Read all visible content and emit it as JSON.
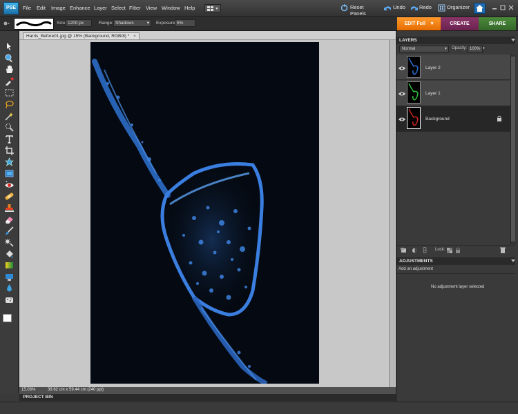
{
  "app": {
    "logo": "PSE"
  },
  "menu": [
    "File",
    "Edit",
    "Image",
    "Enhance",
    "Layer",
    "Select",
    "Filter",
    "View",
    "Window",
    "Help"
  ],
  "menu_right": {
    "reset_panels": "Reset Panels",
    "undo": "Undo",
    "redo": "Redo",
    "organizer": "Organizer"
  },
  "options": {
    "size_label": "Size:",
    "size_value": "1200 px",
    "range_label": "Range:",
    "range_value": "Shadows",
    "exposure_label": "Exposure:",
    "exposure_value": "5%"
  },
  "modes": {
    "edit": "EDIT Full",
    "create": "CREATE",
    "share": "SHARE"
  },
  "document": {
    "tab_title": "Harris_Before01.jpg @ 15% (Background, RGB/8) *"
  },
  "status": {
    "zoom": "15.03%",
    "info": "39.62 cm x 59.44 cm (240 ppi)"
  },
  "project_bin": {
    "label": "PROJECT BIN"
  },
  "layers_panel": {
    "title": "LAYERS",
    "blend_mode": "Normal",
    "opacity_label": "Opacity:",
    "opacity_value": "100%",
    "layers": [
      {
        "name": "Layer 2",
        "color": "#2a6fd0"
      },
      {
        "name": "Layer 1",
        "color": "#2ec43a"
      },
      {
        "name": "Background",
        "color": "#c8281e"
      }
    ],
    "lock_label": "Lock:"
  },
  "adjustments_panel": {
    "title": "ADJUSTMENTS",
    "add_label": "Add an adjustment",
    "empty_message": "No adjustment layer selected"
  }
}
